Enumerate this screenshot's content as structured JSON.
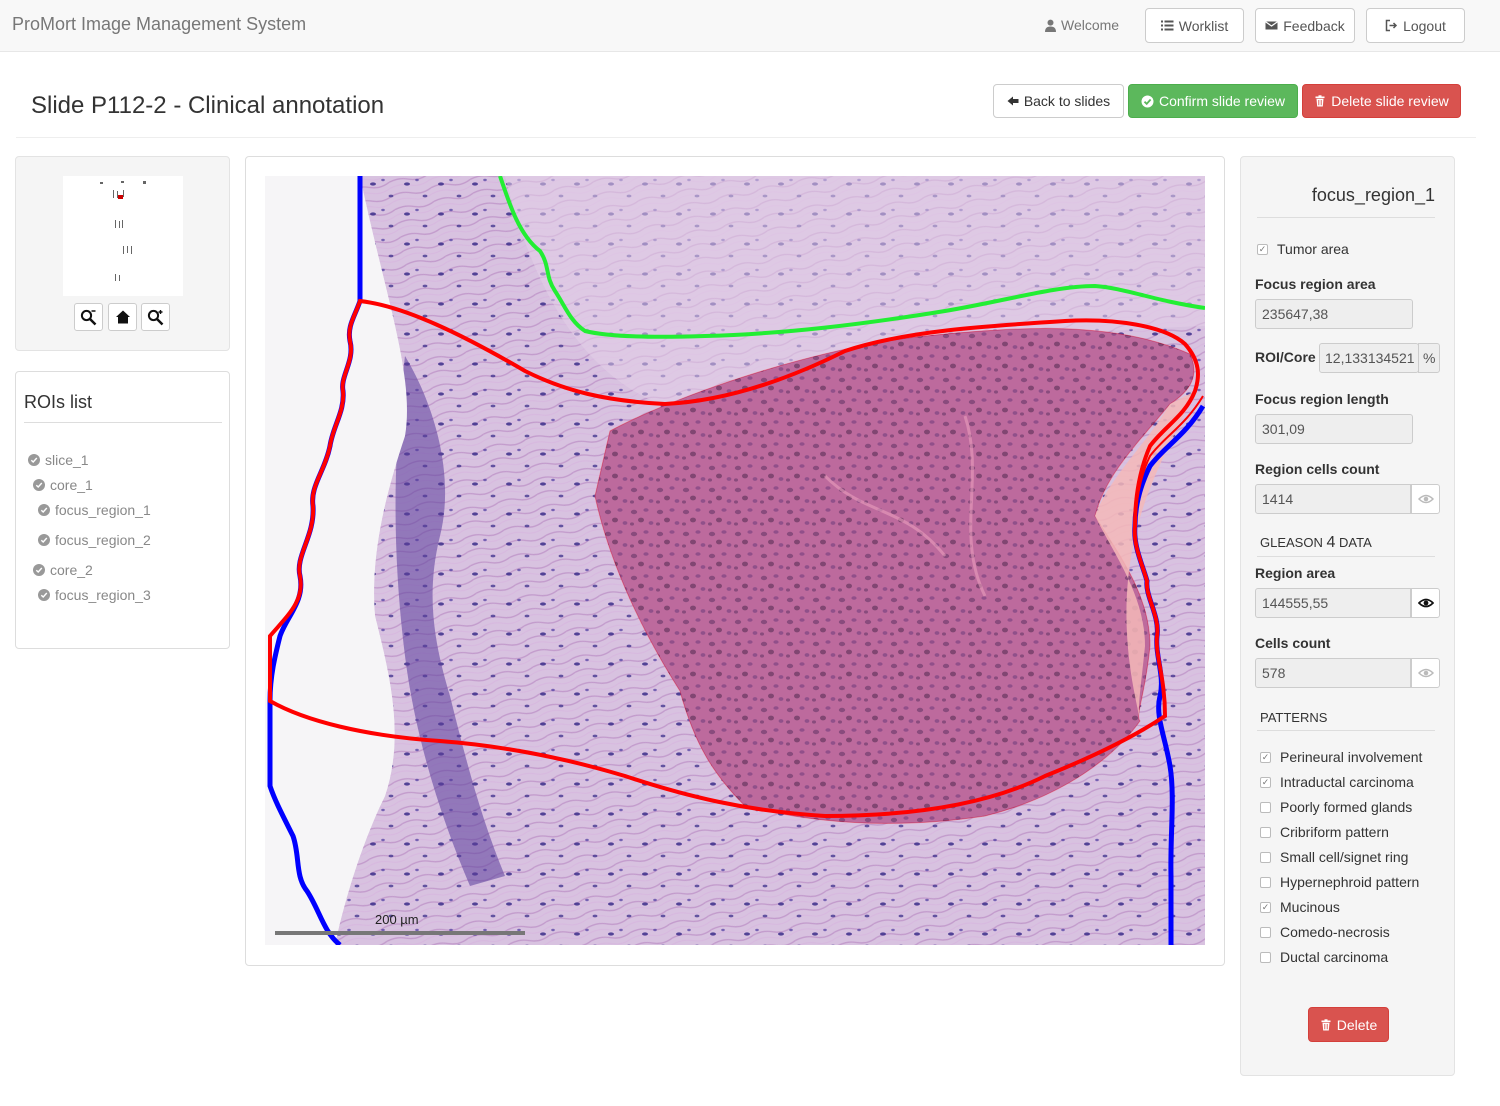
{
  "navbar": {
    "brand": "ProMort Image Management System",
    "welcome": "Welcome",
    "worklist": "Worklist",
    "feedback": "Feedback",
    "logout": "Logout"
  },
  "header": {
    "title": "Slide P112-2 - Clinical annotation",
    "back": "Back to slides",
    "confirm": "Confirm slide review",
    "delete": "Delete slide review"
  },
  "colors": {
    "success": "#5cb85c",
    "danger": "#d9534f",
    "slice_outline": "#0000ff",
    "core_outline": "#ff0000",
    "focus_region_outline": "#00e000"
  },
  "rois": {
    "title": "ROIs list",
    "items": [
      {
        "label": "slice_1"
      },
      {
        "label": "core_1"
      },
      {
        "label": "focus_region_1"
      },
      {
        "label": "focus_region_2"
      },
      {
        "label": "core_2"
      },
      {
        "label": "focus_region_3"
      }
    ]
  },
  "viewer": {
    "scale_label": "200 µm"
  },
  "details": {
    "title": "focus_region_1",
    "tumor_area": {
      "label": "Tumor area",
      "checked": true
    },
    "focus_region_area": {
      "label": "Focus region area",
      "value": "235647,38"
    },
    "roi_core": {
      "label": "ROI/Core",
      "value": "12,133134521",
      "unit": "%"
    },
    "focus_region_length": {
      "label": "Focus region length",
      "value": "301,09"
    },
    "region_cells_count": {
      "label": "Region cells count",
      "value": "1414"
    },
    "gleason_header": {
      "prefix": "GLEASON",
      "number": "4",
      "suffix": "DATA"
    },
    "region_area": {
      "label": "Region area",
      "value": "144555,55"
    },
    "cells_count": {
      "label": "Cells count",
      "value": "578"
    },
    "patterns_header": "PATTERNS",
    "patterns": [
      {
        "label": "Perineural involvement",
        "checked": true
      },
      {
        "label": "Intraductal carcinoma",
        "checked": true
      },
      {
        "label": "Poorly formed glands",
        "checked": false
      },
      {
        "label": "Cribriform pattern",
        "checked": false
      },
      {
        "label": "Small cell/signet ring",
        "checked": false
      },
      {
        "label": "Hypernephroid pattern",
        "checked": false
      },
      {
        "label": "Mucinous",
        "checked": true
      },
      {
        "label": "Comedo-necrosis",
        "checked": false
      },
      {
        "label": "Ductal carcinoma",
        "checked": false
      }
    ],
    "delete": "Delete"
  }
}
